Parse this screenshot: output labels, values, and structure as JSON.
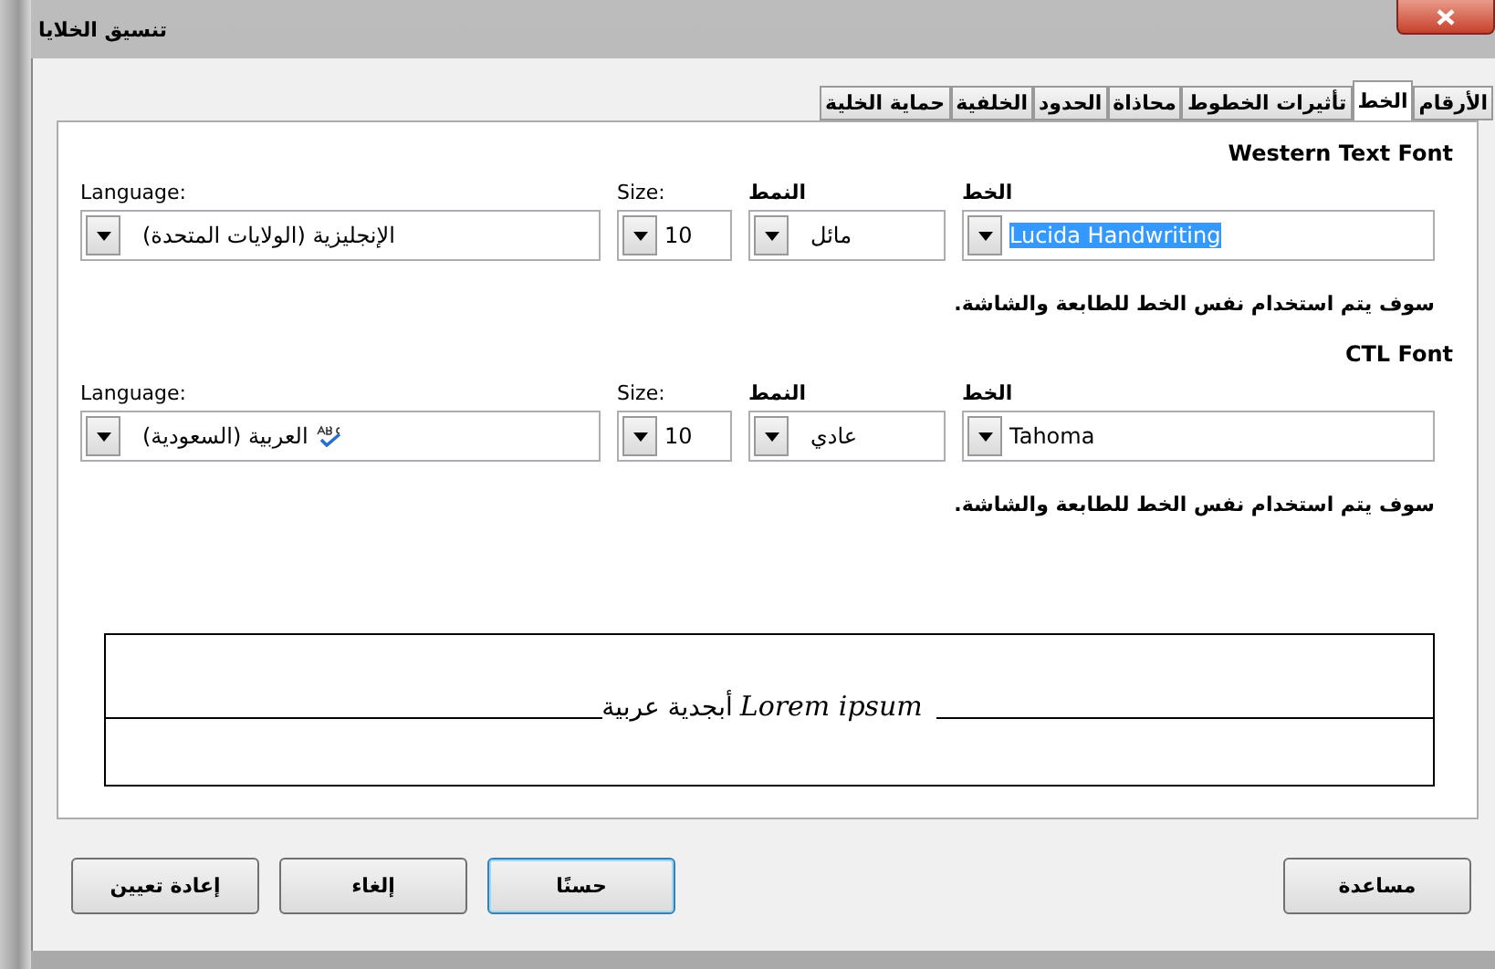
{
  "window": {
    "title": "تنسيق الخلايا"
  },
  "tabs": [
    {
      "label": "الأرقام",
      "selected": false
    },
    {
      "label": "الخط",
      "selected": true
    },
    {
      "label": "تأثيرات الخطوط",
      "selected": false
    },
    {
      "label": "محاذاة",
      "selected": false
    },
    {
      "label": "الحدود",
      "selected": false
    },
    {
      "label": "الخلفية",
      "selected": false
    },
    {
      "label": "حماية الخلية",
      "selected": false
    }
  ],
  "sections": [
    {
      "heading": "Western Text Font",
      "note": "سوف يتم استخدام نفس الخط للطابعة والشاشة.",
      "fields": [
        {
          "kind": "font",
          "label": "الخط",
          "value": "Lucida Handwriting",
          "highlighted": true,
          "spellcheck_icon": false
        },
        {
          "kind": "style",
          "label": "النمط",
          "value": "مائل",
          "highlighted": false,
          "spellcheck_icon": false
        },
        {
          "kind": "size",
          "label": "Size:",
          "value": "10",
          "highlighted": false,
          "spellcheck_icon": false
        },
        {
          "kind": "language",
          "label": "Language:",
          "value": "الإنجليزية (الولايات المتحدة)",
          "highlighted": false,
          "spellcheck_icon": false
        }
      ]
    },
    {
      "heading": "CTL Font",
      "note": "سوف يتم استخدام نفس الخط للطابعة والشاشة.",
      "fields": [
        {
          "kind": "font",
          "label": "الخط",
          "value": "Tahoma",
          "highlighted": false,
          "spellcheck_icon": false
        },
        {
          "kind": "style",
          "label": "النمط",
          "value": "عادي",
          "highlighted": false,
          "spellcheck_icon": false
        },
        {
          "kind": "size",
          "label": "Size:",
          "value": "10",
          "highlighted": false,
          "spellcheck_icon": false
        },
        {
          "kind": "language",
          "label": "Language:",
          "value": "العربية (السعودية)",
          "highlighted": false,
          "spellcheck_icon": true
        }
      ]
    }
  ],
  "preview": {
    "western_sample": "Lorem ipsum",
    "ctl_sample": "أبجدية عربية"
  },
  "left_buttons": [
    {
      "label": "حسنًا",
      "default": true
    },
    {
      "label": "إلغاء",
      "default": false
    },
    {
      "label": "إعادة تعيين",
      "default": false
    }
  ],
  "right_buttons": [
    {
      "label": "مساعدة",
      "default": false
    }
  ]
}
